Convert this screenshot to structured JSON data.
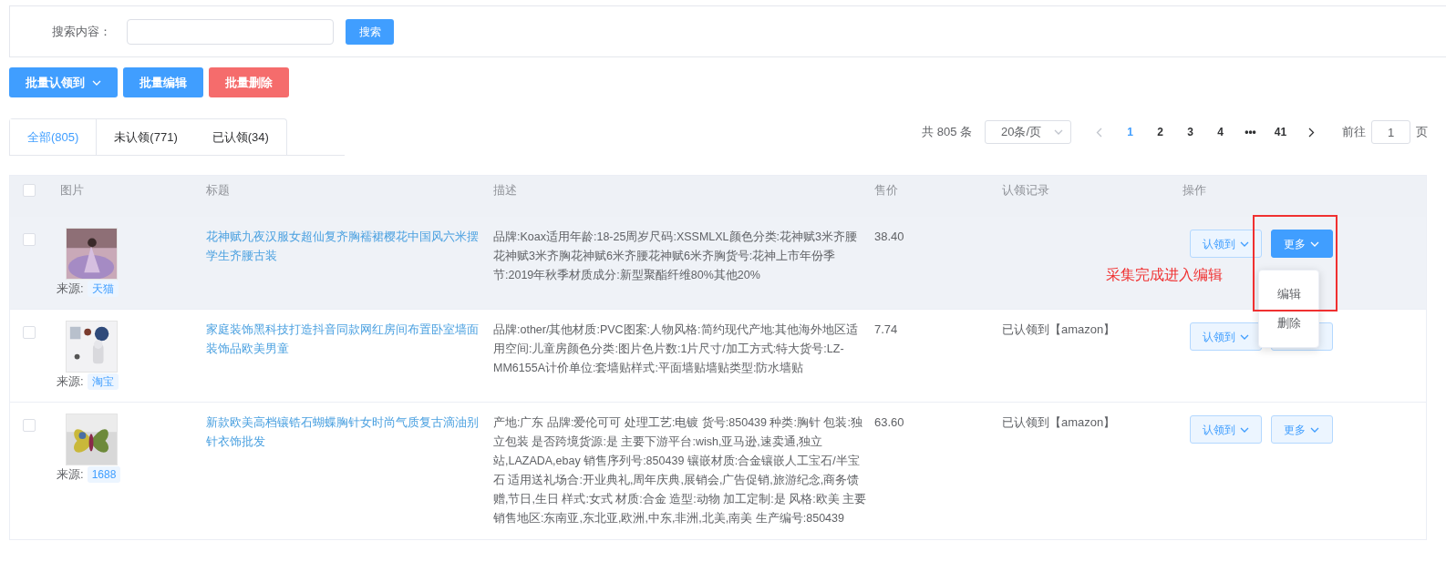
{
  "search": {
    "label": "搜索内容：",
    "button": "搜索"
  },
  "bulk_actions": [
    {
      "label": "批量认领到",
      "kind": "dropdown",
      "color": "#409eff"
    },
    {
      "label": "批量编辑",
      "kind": "plain",
      "color": "#409eff"
    },
    {
      "label": "批量删除",
      "kind": "plain",
      "color": "#f56c6c"
    }
  ],
  "tabs": [
    {
      "label": "全部(805)",
      "selected": true
    },
    {
      "label": "未认领(771)",
      "selected": false
    },
    {
      "label": "已认领(34)",
      "selected": false
    }
  ],
  "pagination": {
    "total": "共 805 条",
    "page_size": "20条/页",
    "pages": [
      {
        "label": "1",
        "selected": true
      },
      {
        "label": "2",
        "selected": false
      },
      {
        "label": "3",
        "selected": false
      },
      {
        "label": "4",
        "selected": false
      },
      {
        "label": "•••",
        "selected": false
      },
      {
        "label": "41",
        "selected": false
      }
    ],
    "goto_label": "前往",
    "goto_value": "1",
    "goto_suffix": "页"
  },
  "table": {
    "all_checked": false,
    "columns": [
      "图片",
      "标题",
      "描述",
      "售价",
      "认领记录",
      "操作"
    ],
    "rows": [
      {
        "checked": false,
        "highlighted": true,
        "source_label": "来源:",
        "source": "天猫",
        "title": "花神赋九夜汉服女超仙复齐胸襦裙樱花中国风六米摆学生齐腰古装",
        "description": "品牌:Koax适用年龄:18-25周岁尺码:XSSMLXL颜色分类:花神赋3米齐腰花神赋3米齐胸花神赋6米齐腰花神赋6米齐胸货号:花神上市年份季节:2019年秋季材质成分:新型聚酯纤维80%其他20%",
        "price": "38.40",
        "claim_record": "",
        "claim_button": "认领到",
        "more_button": {
          "label": "更多",
          "active": true
        }
      },
      {
        "checked": false,
        "highlighted": false,
        "source_label": "来源:",
        "source": "淘宝",
        "title": "家庭装饰黑科技打造抖音同款网红房间布置卧室墙面装饰品欧美男童",
        "description": "品牌:other/其他材质:PVC图案:人物风格:简约现代产地:其他海外地区适用空间:儿童房颜色分类:图片色片数:1片尺寸/加工方式:特大货号:LZ-MM6155A计价单位:套墙贴样式:平面墙贴墙贴类型:防水墙贴",
        "price": "7.74",
        "claim_record": "已认领到【amazon】",
        "claim_button": "认领到",
        "more_button": {
          "active": false
        }
      },
      {
        "checked": false,
        "highlighted": false,
        "source_label": "来源:",
        "source": "1688",
        "title": "新款欧美高档镶锆石蝴蝶胸针女时尚气质复古滴油别针衣饰批发",
        "description": "产地:广东 品牌:爱伦可可 处理工艺:电镀 货号:850439 种类:胸针 包装:独立包装 是否跨境货源:是 主要下游平台:wish,亚马逊,速卖通,独立站,LAZADA,ebay 销售序列号:850439 镶嵌材质:合金镶嵌人工宝石/半宝石 适用送礼场合:开业典礼,周年庆典,展销会,广告促销,旅游纪念,商务馈赠,节日,生日 样式:女式 材质:合金 造型:动物 加工定制:是 风格:欧美 主要销售地区:东南亚,东北亚,欧洲,中东,非洲,北美,南美 生产编号:850439",
        "price": "63.60",
        "claim_record": "已认领到【amazon】",
        "claim_button": "认领到",
        "more_button": {
          "label": "更多",
          "active": false
        }
      }
    ]
  },
  "dropdown_menu": {
    "items": [
      "编辑",
      "删除"
    ]
  },
  "annotation": {
    "text": "采集完成进入编辑"
  }
}
